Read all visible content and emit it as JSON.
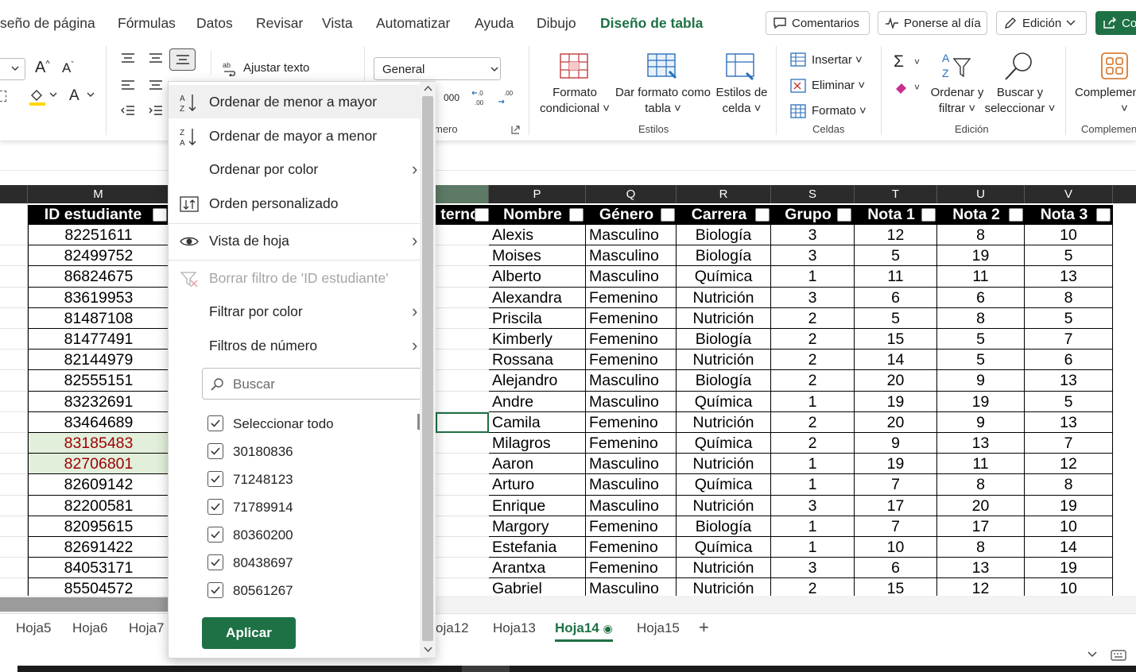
{
  "menu": {
    "tabs": [
      "seño de página",
      "Fórmulas",
      "Datos",
      "Revisar",
      "Vista",
      "Automatizar",
      "Ayuda",
      "Dibujo",
      "Diseño de tabla"
    ],
    "comments": "Comentarios",
    "catchup": "Ponerse al día",
    "editing": "Edición",
    "share": "Co"
  },
  "ribbon": {
    "wrap_text": "Ajustar texto",
    "number_format": "General",
    "thousands": "000",
    "number_group": "mero",
    "cond_format": [
      "Formato",
      "condicional"
    ],
    "table_format": [
      "Dar formato como",
      "tabla"
    ],
    "cell_styles": [
      "Estilos de",
      "celda"
    ],
    "styles_group": "Estilos",
    "insert": "Insertar",
    "delete": "Eliminar",
    "format": "Formato",
    "cells_group": "Celdas",
    "sort_filter": [
      "Ordenar y",
      "filtrar"
    ],
    "find_select": [
      "Buscar y",
      "seleccionar"
    ],
    "editing_group": "Edición",
    "addins": "Complemen",
    "addins_group": "Complemen"
  },
  "columns": {
    "letters": [
      "M",
      "P",
      "Q",
      "R",
      "S",
      "T",
      "U",
      "V"
    ],
    "headers": [
      "ID estudiante",
      "terno",
      "Nombre",
      "Género",
      "Carrera",
      "Grupo",
      "Nota 1",
      "Nota 2",
      "Nota 3"
    ]
  },
  "rows": [
    [
      "82251611",
      "Alexis",
      "Masculino",
      "Biología",
      "3",
      "12",
      "8",
      "10"
    ],
    [
      "82499752",
      "Moises",
      "Masculino",
      "Biología",
      "3",
      "5",
      "19",
      "5"
    ],
    [
      "86824675",
      "Alberto",
      "Masculino",
      "Química",
      "1",
      "11",
      "11",
      "13"
    ],
    [
      "83619953",
      "Alexandra",
      "Femenino",
      "Nutrición",
      "3",
      "6",
      "6",
      "8"
    ],
    [
      "81487108",
      "Priscila",
      "Femenino",
      "Nutrición",
      "2",
      "5",
      "8",
      "5"
    ],
    [
      "81477491",
      "Kimberly",
      "Femenino",
      "Biología",
      "2",
      "15",
      "5",
      "7"
    ],
    [
      "82144979",
      "Rossana",
      "Femenino",
      "Nutrición",
      "2",
      "14",
      "5",
      "6"
    ],
    [
      "82555151",
      "Alejandro",
      "Masculino",
      "Biología",
      "2",
      "20",
      "9",
      "13"
    ],
    [
      "83232691",
      "Andre",
      "Masculino",
      "Química",
      "1",
      "19",
      "19",
      "5"
    ],
    [
      "83464689",
      "Camila",
      "Femenino",
      "Nutrición",
      "2",
      "20",
      "9",
      "13"
    ],
    [
      "83185483",
      "Milagros",
      "Femenino",
      "Química",
      "2",
      "9",
      "13",
      "7"
    ],
    [
      "82706801",
      "Aaron",
      "Masculino",
      "Nutrición",
      "1",
      "19",
      "11",
      "12"
    ],
    [
      "82609142",
      "Arturo",
      "Masculino",
      "Química",
      "1",
      "7",
      "8",
      "8"
    ],
    [
      "82200581",
      "Enrique",
      "Masculino",
      "Nutrición",
      "3",
      "17",
      "20",
      "19"
    ],
    [
      "82095615",
      "Margory",
      "Femenino",
      "Biología",
      "1",
      "7",
      "17",
      "10"
    ],
    [
      "82691422",
      "Estefania",
      "Femenino",
      "Química",
      "1",
      "10",
      "8",
      "14"
    ],
    [
      "84053171",
      "Arantxa",
      "Femenino",
      "Nutrición",
      "3",
      "6",
      "13",
      "19"
    ],
    [
      "85504572",
      "Gabriel",
      "Masculino",
      "Nutrición",
      "2",
      "15",
      "12",
      "10"
    ]
  ],
  "highlighted_rows": [
    10,
    11
  ],
  "colors": {
    "accent": "#1e7145",
    "highlight_fill": "#e2efda",
    "highlight_text": "#9c0006"
  },
  "dropdown": {
    "sort_asc": "Ordenar de menor a mayor",
    "sort_desc": "Ordenar de mayor a menor",
    "sort_color": "Ordenar por color",
    "custom_sort": "Orden personalizado",
    "sheet_view": "Vista de hoja",
    "clear_filter": "Borrar filtro de 'ID estudiante'",
    "filter_color": "Filtrar por color",
    "number_filters": "Filtros de número",
    "search_placeholder": "Buscar",
    "select_all": "Seleccionar todo",
    "values": [
      "30180836",
      "71248123",
      "71789914",
      "80360200",
      "80438697",
      "80561267"
    ],
    "apply": "Aplicar"
  },
  "sheets": {
    "tabs": [
      "Hoja5",
      "Hoja6",
      "Hoja7",
      "oja12",
      "Hoja13",
      "Hoja14",
      "Hoja15"
    ],
    "active": "Hoja14",
    "add": "+"
  }
}
